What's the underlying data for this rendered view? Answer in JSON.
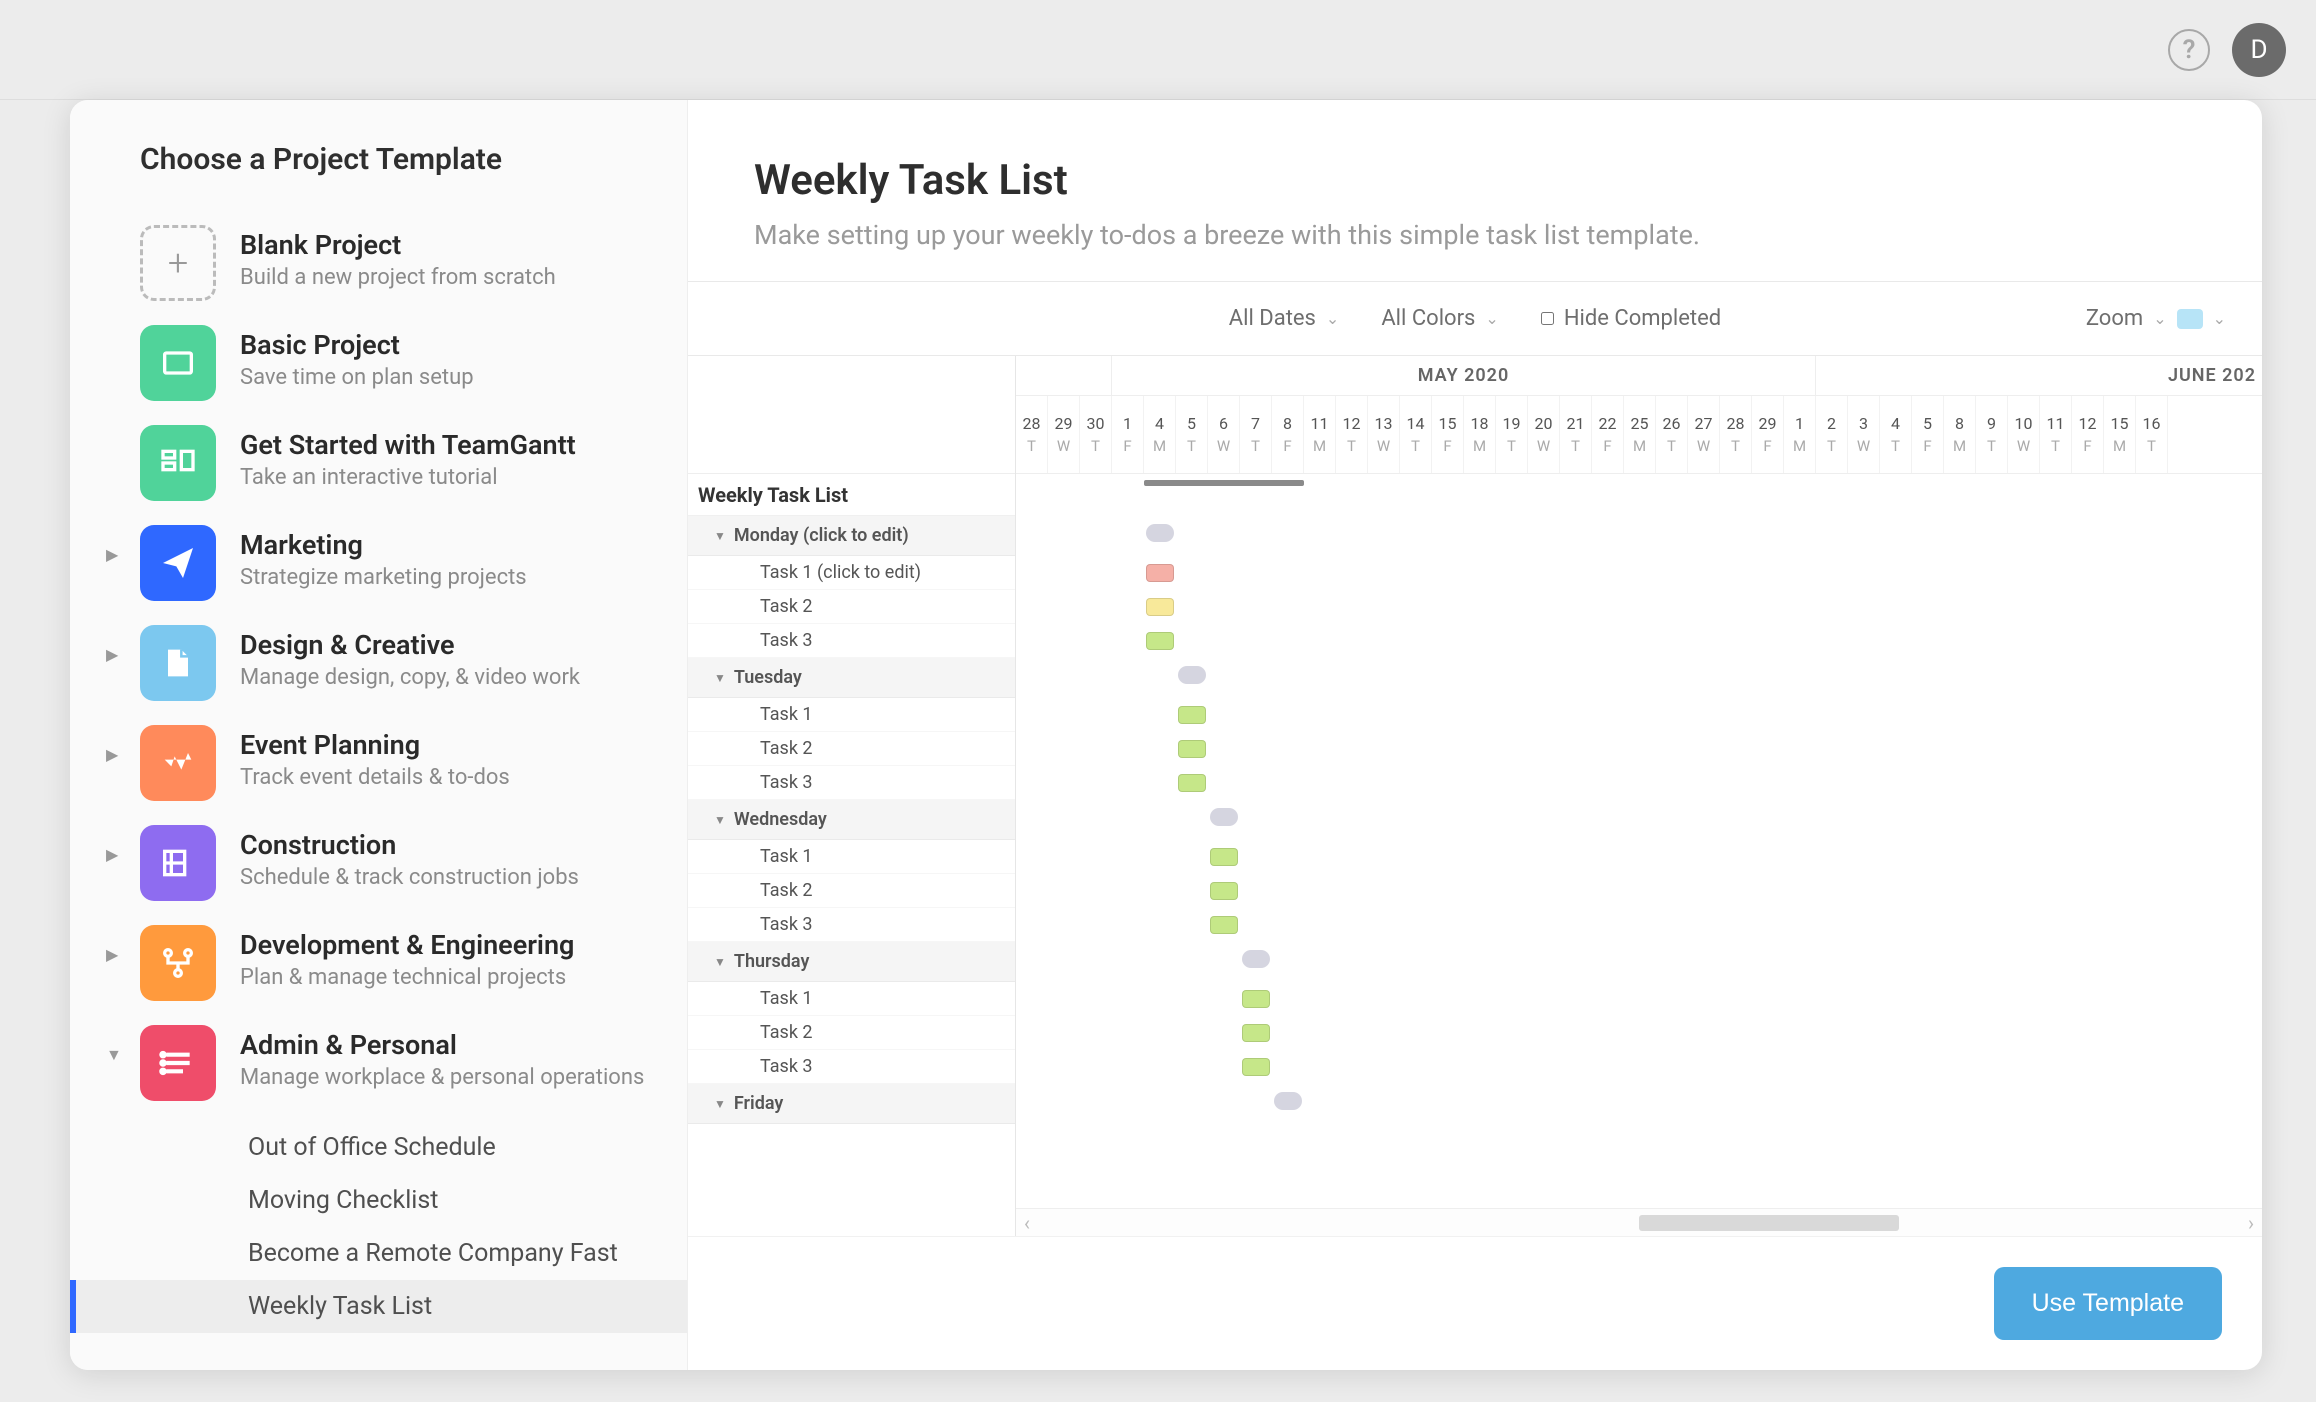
{
  "topbar": {
    "avatar_letter": "D"
  },
  "sidebar": {
    "title": "Choose a Project Template",
    "templates": [
      {
        "name": "Blank Project",
        "desc": "Build a new project from scratch",
        "icon": "blank",
        "color": "#ffffff"
      },
      {
        "name": "Basic Project",
        "desc": "Save time on plan setup",
        "icon": "basic",
        "color": "#50d39a"
      },
      {
        "name": "Get Started with TeamGantt",
        "desc": "Take an interactive tutorial",
        "icon": "tutorial",
        "color": "#50d39a"
      },
      {
        "name": "Marketing",
        "desc": "Strategize marketing projects",
        "icon": "marketing",
        "color": "#2f68ff",
        "expandable": true
      },
      {
        "name": "Design & Creative",
        "desc": "Manage design, copy, & video work",
        "icon": "design",
        "color": "#7cc8ef",
        "expandable": true
      },
      {
        "name": "Event Planning",
        "desc": "Track event details & to-dos",
        "icon": "event",
        "color": "#ff8a5b",
        "expandable": true
      },
      {
        "name": "Construction",
        "desc": "Schedule & track construction jobs",
        "icon": "construction",
        "color": "#8e6cf0",
        "expandable": true
      },
      {
        "name": "Development & Engineering",
        "desc": "Plan & manage technical projects",
        "icon": "dev",
        "color": "#ff9a3d",
        "expandable": true
      },
      {
        "name": "Admin & Personal",
        "desc": "Manage workplace & personal operations",
        "icon": "admin",
        "color": "#ef4d6a",
        "expandable": true,
        "open": true
      }
    ],
    "sub_templates": [
      "Out of Office Schedule",
      "Moving Checklist",
      "Become a Remote Company Fast",
      "Weekly Task List"
    ],
    "selected_sub": "Weekly Task List"
  },
  "main": {
    "title": "Weekly Task List",
    "subtitle": "Make setting up your weekly to-dos a breeze with this simple task list template.",
    "use_button": "Use Template"
  },
  "filters": {
    "dates": "All Dates",
    "colors": "All Colors",
    "hide_completed": "Hide Completed",
    "zoom": "Zoom"
  },
  "timeline": {
    "months": [
      "MAY 2020",
      "JUNE 202"
    ],
    "dates": [
      {
        "n": "28",
        "d": "T"
      },
      {
        "n": "29",
        "d": "W"
      },
      {
        "n": "30",
        "d": "T"
      },
      {
        "n": "1",
        "d": "F"
      },
      {
        "n": "4",
        "d": "M"
      },
      {
        "n": "5",
        "d": "T"
      },
      {
        "n": "6",
        "d": "W"
      },
      {
        "n": "7",
        "d": "T"
      },
      {
        "n": "8",
        "d": "F"
      },
      {
        "n": "11",
        "d": "M"
      },
      {
        "n": "12",
        "d": "T"
      },
      {
        "n": "13",
        "d": "W"
      },
      {
        "n": "14",
        "d": "T"
      },
      {
        "n": "15",
        "d": "F"
      },
      {
        "n": "18",
        "d": "M"
      },
      {
        "n": "19",
        "d": "T"
      },
      {
        "n": "20",
        "d": "W"
      },
      {
        "n": "21",
        "d": "T"
      },
      {
        "n": "22",
        "d": "F"
      },
      {
        "n": "25",
        "d": "M"
      },
      {
        "n": "26",
        "d": "T"
      },
      {
        "n": "27",
        "d": "W"
      },
      {
        "n": "28",
        "d": "T"
      },
      {
        "n": "29",
        "d": "F"
      },
      {
        "n": "1",
        "d": "M"
      },
      {
        "n": "2",
        "d": "T"
      },
      {
        "n": "3",
        "d": "W"
      },
      {
        "n": "4",
        "d": "T"
      },
      {
        "n": "5",
        "d": "F"
      },
      {
        "n": "8",
        "d": "M"
      },
      {
        "n": "9",
        "d": "T"
      },
      {
        "n": "10",
        "d": "W"
      },
      {
        "n": "11",
        "d": "T"
      },
      {
        "n": "12",
        "d": "F"
      },
      {
        "n": "15",
        "d": "M"
      },
      {
        "n": "16",
        "d": "T"
      }
    ],
    "project_label": "Weekly Task List",
    "groups": [
      {
        "name": "Monday (click to edit)",
        "pill_col": 4,
        "pill_color": "gray",
        "tasks": [
          {
            "name": "Task 1 (click to edit)",
            "col": 4,
            "color": "red"
          },
          {
            "name": "Task 2",
            "col": 4,
            "color": "yellow"
          },
          {
            "name": "Task 3",
            "col": 4,
            "color": "green"
          }
        ]
      },
      {
        "name": "Tuesday",
        "pill_col": 5,
        "pill_color": "gray",
        "tasks": [
          {
            "name": "Task 1",
            "col": 5,
            "color": "green"
          },
          {
            "name": "Task 2",
            "col": 5,
            "color": "green"
          },
          {
            "name": "Task 3",
            "col": 5,
            "color": "green"
          }
        ]
      },
      {
        "name": "Wednesday",
        "pill_col": 6,
        "pill_color": "gray",
        "tasks": [
          {
            "name": "Task 1",
            "col": 6,
            "color": "green"
          },
          {
            "name": "Task 2",
            "col": 6,
            "color": "green"
          },
          {
            "name": "Task 3",
            "col": 6,
            "color": "green"
          }
        ]
      },
      {
        "name": "Thursday",
        "pill_col": 7,
        "pill_color": "gray",
        "tasks": [
          {
            "name": "Task 1",
            "col": 7,
            "color": "green"
          },
          {
            "name": "Task 2",
            "col": 7,
            "color": "green"
          },
          {
            "name": "Task 3",
            "col": 7,
            "color": "green"
          }
        ]
      },
      {
        "name": "Friday",
        "pill_col": 8,
        "pill_color": "gray",
        "tasks": []
      }
    ]
  }
}
